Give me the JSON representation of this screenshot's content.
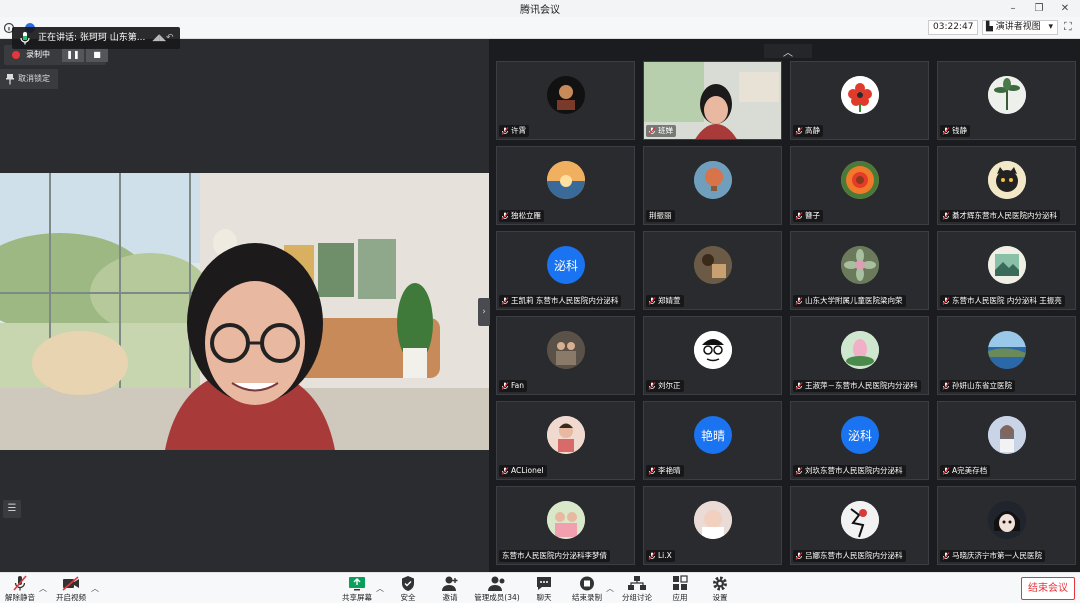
{
  "window": {
    "title": "腾讯会议"
  },
  "topbar": {
    "timer": "03:22:47",
    "view_label": "演讲者视图"
  },
  "left_panel": {
    "speaking": "正在讲话: 张珂珂 山东第...",
    "recording_label": "录制中",
    "unpin_label": "取消锁定"
  },
  "participants": [
    {
      "name": "许霄",
      "muted": true,
      "avatar": "photo-dark",
      "color": "#1c1c1c"
    },
    {
      "name": "班婵",
      "muted": true,
      "avatar": "video",
      "color": "#8a9a88"
    },
    {
      "name": "高静",
      "muted": true,
      "avatar": "flower-red",
      "color": "#ffffff"
    },
    {
      "name": "钱静",
      "muted": true,
      "avatar": "plant",
      "color": "#e8ece6"
    },
    {
      "name": "独松立雁",
      "muted": true,
      "avatar": "sunset",
      "color": "#e2a35c"
    },
    {
      "name": "荆振丽",
      "muted": false,
      "avatar": "balloon",
      "color": "#6f9fbd"
    },
    {
      "name": "簪子",
      "muted": true,
      "avatar": "flower-orange",
      "color": "#f08a2a"
    },
    {
      "name": "綦才辉东营市人民医院内分泌科",
      "muted": true,
      "avatar": "cat",
      "color": "#f2e7c7"
    },
    {
      "name": "王凯莉 东营市人民医院内分泌科",
      "muted": true,
      "avatar": "text",
      "text": "泌科",
      "color": "#1a73f0"
    },
    {
      "name": "郑婧萱",
      "muted": true,
      "avatar": "photo-brown",
      "color": "#6b5a45"
    },
    {
      "name": "山东大学附属儿童医院梁向荣",
      "muted": true,
      "avatar": "succulent",
      "color": "#8aa07a"
    },
    {
      "name": "东营市人民医院 内分泌科 王振亮",
      "muted": true,
      "avatar": "painting",
      "color": "#a8c8a0"
    },
    {
      "name": "Fan",
      "muted": true,
      "avatar": "photo-people",
      "color": "#5a5248"
    },
    {
      "name": "刘尔正",
      "muted": true,
      "avatar": "cartoon",
      "color": "#ffffff"
    },
    {
      "name": "王淑萍－东营市人民医院内分泌科",
      "muted": true,
      "avatar": "lotus",
      "color": "#cfe6cf"
    },
    {
      "name": "孙妍山东省立医院",
      "muted": true,
      "avatar": "sea",
      "color": "#3b78b8"
    },
    {
      "name": "ACLionel",
      "muted": true,
      "avatar": "kids",
      "color": "#f0d9cf"
    },
    {
      "name": "李艳晴",
      "muted": true,
      "avatar": "text",
      "text": "艳晴",
      "color": "#1a73f0"
    },
    {
      "name": "刘玖东营市人民医院内分泌科",
      "muted": true,
      "avatar": "text",
      "text": "泌科",
      "color": "#1a73f0"
    },
    {
      "name": "A完美存档",
      "muted": true,
      "avatar": "girl",
      "color": "#c9d4e6"
    },
    {
      "name": "东营市人民医院内分泌科李梦倩",
      "muted": false,
      "avatar": "family",
      "color": "#d8e8c8"
    },
    {
      "name": "Li.X",
      "muted": true,
      "avatar": "baby",
      "color": "#eadbd6"
    },
    {
      "name": "吕娜东营市人民医院内分泌科",
      "muted": true,
      "avatar": "comic",
      "color": "#f2f2f2"
    },
    {
      "name": "马晓庆济宁市第一人民医院",
      "muted": true,
      "avatar": "anime",
      "color": "#20242c"
    }
  ],
  "toolbar": {
    "unmute": "解除静音",
    "video": "开启视频",
    "share": "共享屏幕",
    "security": "安全",
    "invite": "邀请",
    "members": "管理成员(34)",
    "chat": "聊天",
    "record": "结束录制",
    "breakout": "分组讨论",
    "apps": "应用",
    "settings": "设置",
    "end": "结束会议"
  },
  "colors": {
    "end_red": "#e5363d",
    "accent_blue": "#1a73f0",
    "share_green": "#0a9f5a"
  }
}
